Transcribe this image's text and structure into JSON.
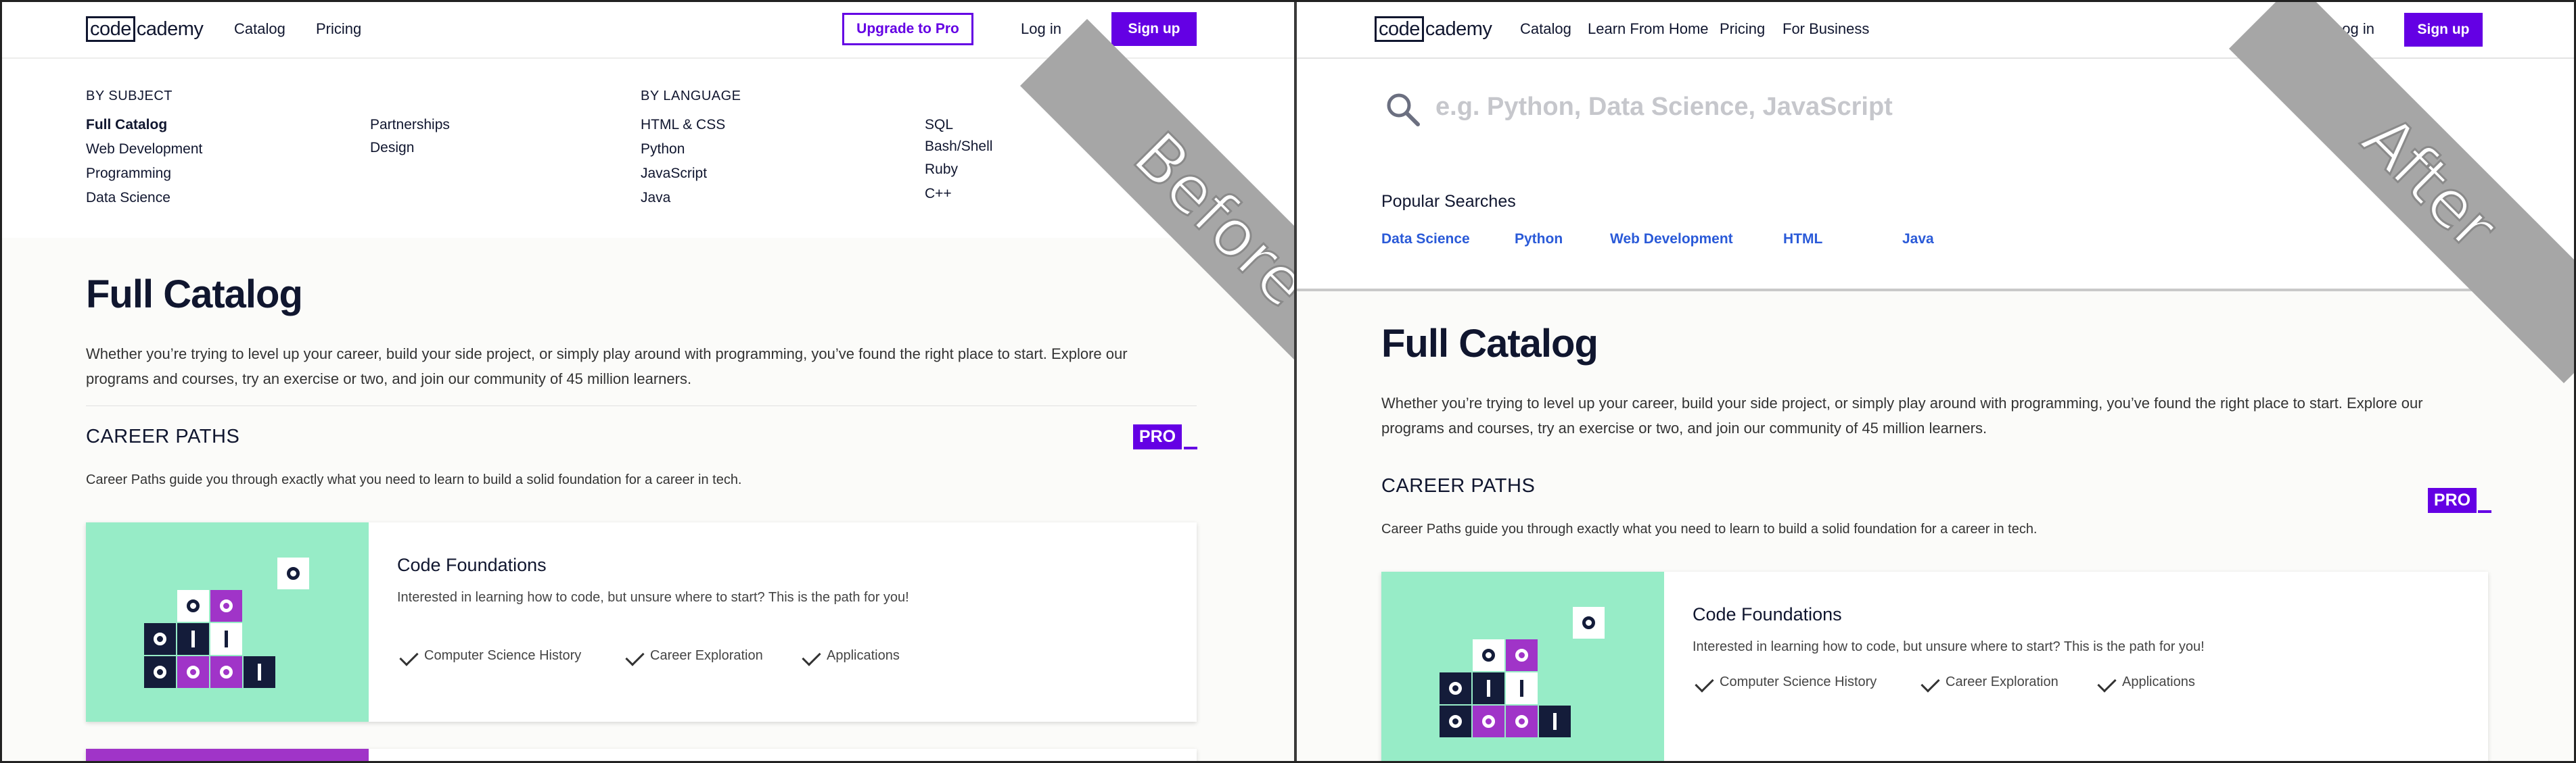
{
  "before": {
    "label": "Before",
    "nav": {
      "logo_code": "code",
      "logo_cademy": "cademy",
      "catalog": "Catalog",
      "pricing": "Pricing",
      "upgrade": "Upgrade to Pro",
      "login": "Log in",
      "signup": "Sign up"
    },
    "menu": {
      "by_subject_heading": "BY SUBJECT",
      "subject_col1": [
        "Full Catalog",
        "Web Development",
        "Programming",
        "Data Science"
      ],
      "subject_col2": [
        "Partnerships",
        "Design"
      ],
      "by_language_heading": "BY LANGUAGE",
      "language_col1": [
        "HTML & CSS",
        "Python",
        "JavaScript",
        "Java"
      ],
      "language_col2": [
        "SQL",
        "Bash/Shell",
        "Ruby",
        "C++"
      ]
    }
  },
  "after": {
    "label": "After",
    "nav": {
      "logo_code": "code",
      "logo_cademy": "cademy",
      "catalog": "Catalog",
      "learn_from_home": "Learn From Home",
      "pricing": "Pricing",
      "for_business": "For Business",
      "login": "Log in",
      "signup": "Sign up"
    },
    "search": {
      "placeholder": "e.g. Python, Data Science, JavaScript"
    },
    "popular": {
      "title": "Popular Searches",
      "links": [
        "Data Science",
        "Python",
        "Web Development",
        "HTML",
        "Java"
      ]
    }
  },
  "catalog": {
    "title": "Full Catalog",
    "intro_line1": "Whether you’re trying to level up your career, build your side project, or simply play around with programming, you’ve found the right place to start. Explore our",
    "intro_line2": "programs and courses, try an exercise or two, and join our community of 45 million learners.",
    "career_paths_title": "CAREER PATHS",
    "pro_badge": "PRO",
    "career_paths_desc": "Career Paths guide you through exactly what you need to learn to build a solid foundation for a career in tech.",
    "card": {
      "title": "Code Foundations",
      "desc": "Interested in learning how to code, but unsure where to start? This is the path for you!",
      "features": [
        "Computer Science History",
        "Career Exploration",
        "Applications"
      ]
    }
  },
  "colors": {
    "brand": "#6400e4",
    "mint": "#97ecc7",
    "purple_block": "#a034c8",
    "dark_block": "#141c3a",
    "link_blue": "#2a5ad8"
  },
  "icons": [
    "search-icon",
    "check-icon"
  ]
}
